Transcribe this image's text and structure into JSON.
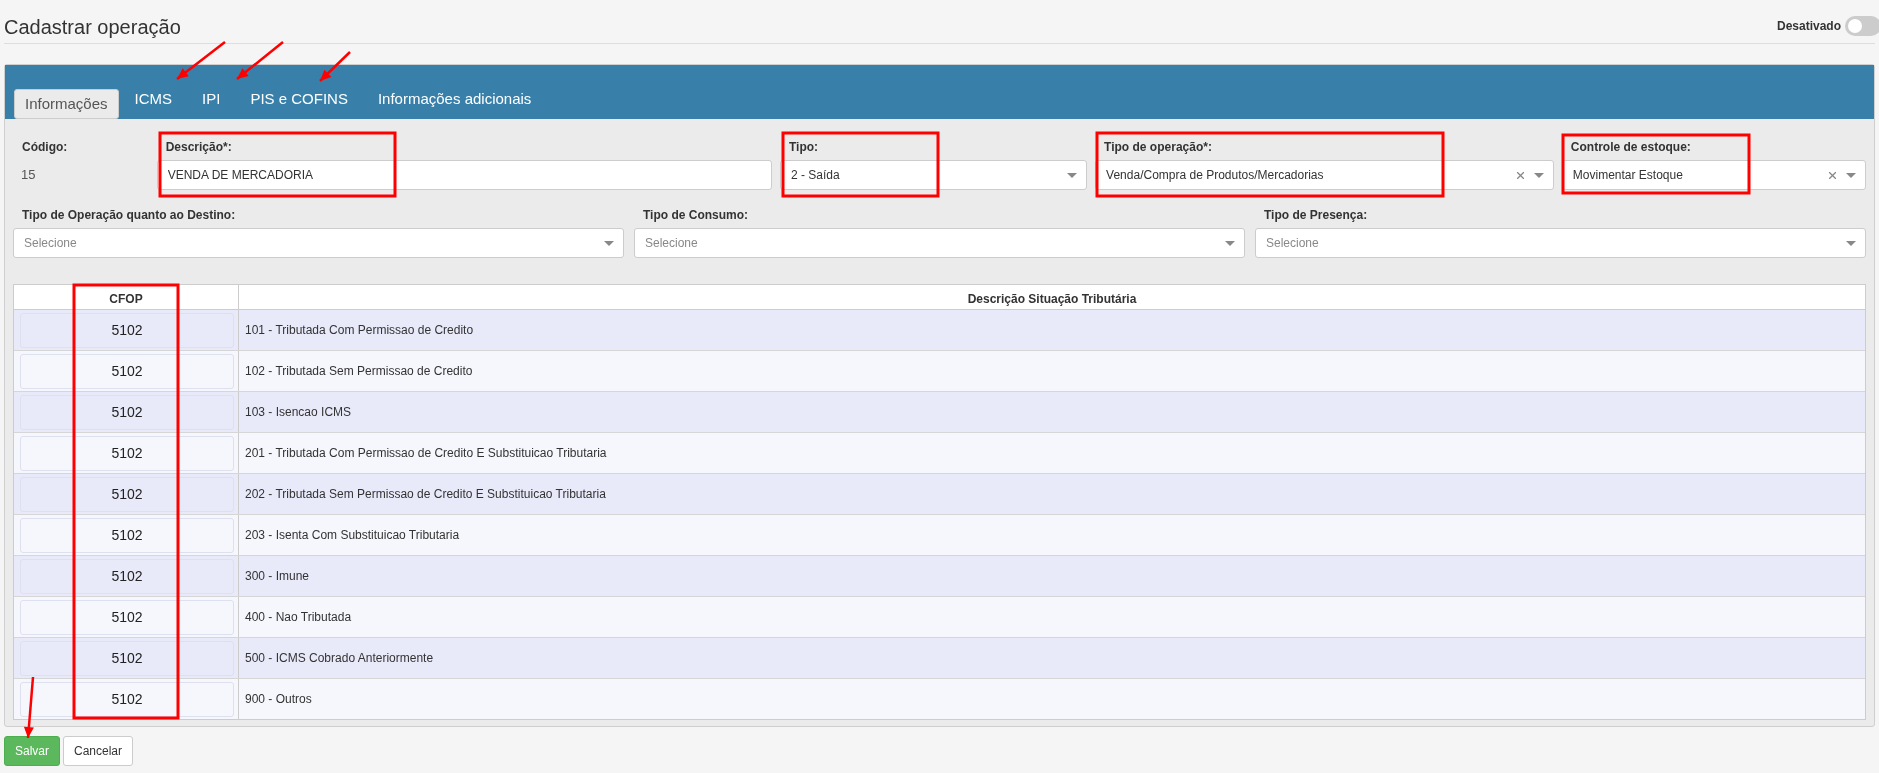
{
  "page": {
    "title": "Cadastrar operação"
  },
  "status_toggle": {
    "label": "Desativado",
    "on": false
  },
  "tabs": [
    {
      "label": "Informações",
      "selected": true
    },
    {
      "label": "ICMS",
      "selected": false
    },
    {
      "label": "IPI",
      "selected": false
    },
    {
      "label": "PIS e COFINS",
      "selected": false
    },
    {
      "label": "Informações adicionais",
      "selected": false
    }
  ],
  "fields_row_1": [
    {
      "label": "Código:",
      "kind": "readonly",
      "value": "15"
    },
    {
      "label": "Descrição*:",
      "kind": "text",
      "value": "VENDA DE MERCADORIA"
    },
    {
      "label": "Tipo:",
      "kind": "select",
      "value": "2 - Saída",
      "clearable": false
    },
    {
      "label": "Tipo de operação*:",
      "kind": "select",
      "value": "Venda/Compra de Produtos/Mercadorias",
      "clearable": true
    },
    {
      "label": "Controle de estoque:",
      "kind": "select",
      "value": "Movimentar Estoque",
      "clearable": true
    }
  ],
  "fields_row_2": [
    {
      "label": "Tipo de Operação quanto ao Destino:",
      "kind": "select",
      "placeholder": "Selecione"
    },
    {
      "label": "Tipo de Consumo:",
      "kind": "select",
      "placeholder": "Selecione"
    },
    {
      "label": "Tipo de Presença:",
      "kind": "select",
      "placeholder": "Selecione"
    }
  ],
  "table": {
    "columns": [
      "CFOP",
      "Descrição Situação Tributária"
    ],
    "rows": [
      {
        "cfop": "5102",
        "descricao": "101 - Tributada Com Permissao de Credito"
      },
      {
        "cfop": "5102",
        "descricao": "102 - Tributada Sem Permissao de Credito"
      },
      {
        "cfop": "5102",
        "descricao": "103 - Isencao ICMS"
      },
      {
        "cfop": "5102",
        "descricao": "201 - Tributada Com Permissao de Credito E Substituicao Tributaria"
      },
      {
        "cfop": "5102",
        "descricao": "202 - Tributada Sem Permissao de Credito E Substituicao Tributaria"
      },
      {
        "cfop": "5102",
        "descricao": "203 - Isenta Com Substituicao Tributaria"
      },
      {
        "cfop": "5102",
        "descricao": "300 - Imune"
      },
      {
        "cfop": "5102",
        "descricao": "400 - Nao Tributada"
      },
      {
        "cfop": "5102",
        "descricao": "500 - ICMS Cobrado Anteriormente"
      },
      {
        "cfop": "5102",
        "descricao": "900 - Outros"
      }
    ]
  },
  "buttons": [
    {
      "label": "Salvar",
      "kind": "primary"
    },
    {
      "label": "Cancelar",
      "kind": "default"
    }
  ]
}
